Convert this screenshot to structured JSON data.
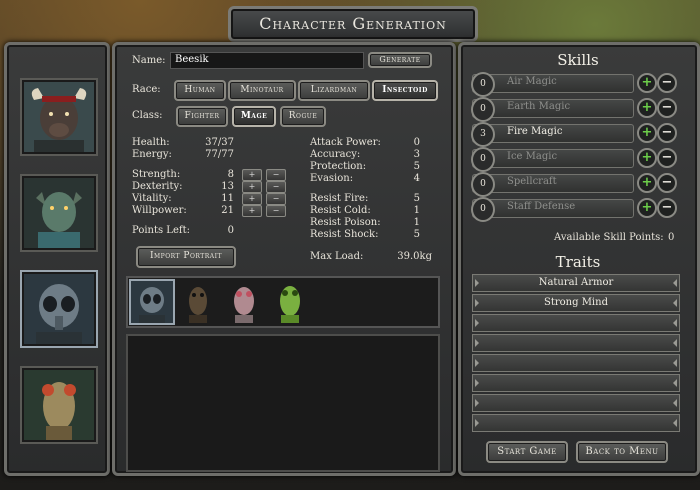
{
  "window": {
    "title": "Character Generation"
  },
  "name_field": {
    "label": "Name:",
    "value": "Beesik",
    "generate_label": "Generate"
  },
  "race": {
    "label": "Race:",
    "options": [
      "Human",
      "Minotaur",
      "Lizardman",
      "Insectoid"
    ],
    "selected": "Insectoid"
  },
  "class": {
    "label": "Class:",
    "options": [
      "Fighter",
      "Mage",
      "Rogue"
    ],
    "selected": "Mage"
  },
  "stats": {
    "health_label": "Health:",
    "health": "37/37",
    "energy_label": "Energy:",
    "energy": "77/77",
    "strength_label": "Strength:",
    "strength": "8",
    "dexterity_label": "Dexterity:",
    "dexterity": "13",
    "vitality_label": "Vitality:",
    "vitality": "11",
    "willpower_label": "Willpower:",
    "willpower": "21",
    "points_left_label": "Points Left:",
    "points_left": "0",
    "plus": "+",
    "minus": "−"
  },
  "combat": {
    "attack_power_label": "Attack Power:",
    "attack_power": "0",
    "accuracy_label": "Accuracy:",
    "accuracy": "3",
    "protection_label": "Protection:",
    "protection": "5",
    "evasion_label": "Evasion:",
    "evasion": "4",
    "resist_fire_label": "Resist Fire:",
    "resist_fire": "5",
    "resist_cold_label": "Resist Cold:",
    "resist_cold": "1",
    "resist_poison_label": "Resist Poison:",
    "resist_poison": "1",
    "resist_shock_label": "Resist Shock:",
    "resist_shock": "5",
    "max_load_label": "Max Load:",
    "max_load": "39.0kg"
  },
  "import_portrait_label": "Import Portrait",
  "skills": {
    "heading": "Skills",
    "items": [
      {
        "name": "Air Magic",
        "points": "0"
      },
      {
        "name": "Earth Magic",
        "points": "0"
      },
      {
        "name": "Fire Magic",
        "points": "3"
      },
      {
        "name": "Ice Magic",
        "points": "0"
      },
      {
        "name": "Spellcraft",
        "points": "0"
      },
      {
        "name": "Staff Defense",
        "points": "0"
      }
    ],
    "available_label": "Available Skill Points:",
    "available": "0",
    "plus": "+",
    "minus": "−"
  },
  "traits": {
    "heading": "Traits",
    "items": [
      "Natural Armor",
      "Strong Mind"
    ]
  },
  "footer": {
    "start_label": "Start Game",
    "back_label": "Back to Menu"
  },
  "colors": {
    "plus_green": "#6ccf4a",
    "panel": "#2f3030",
    "border": "#6e6e6a"
  }
}
